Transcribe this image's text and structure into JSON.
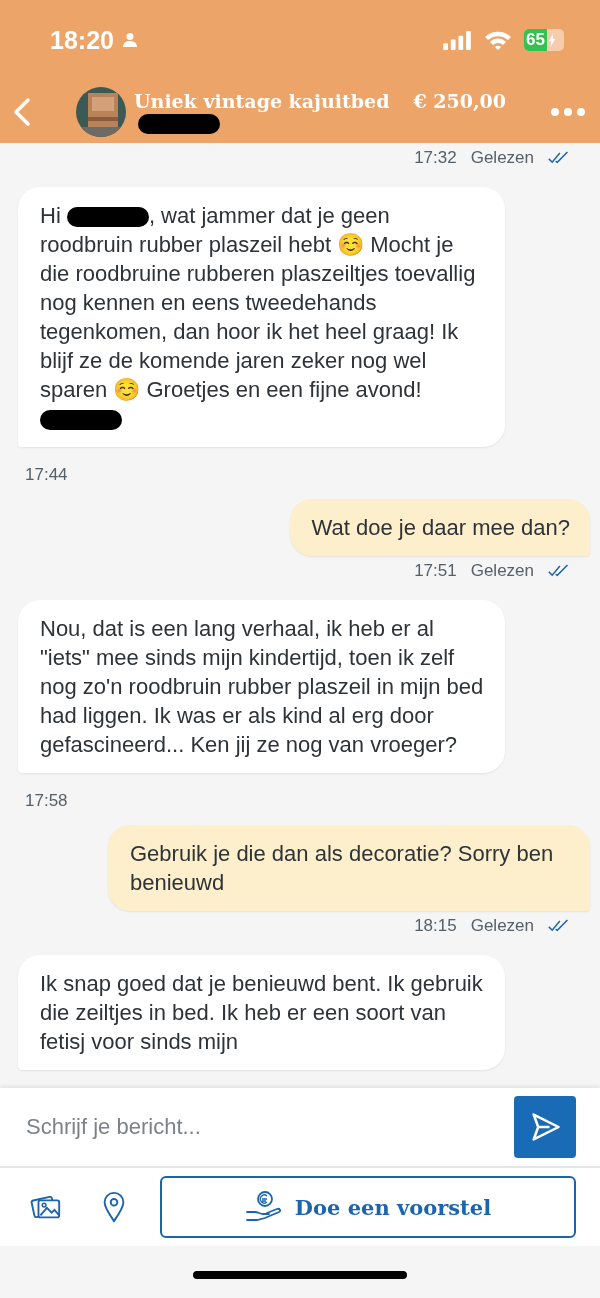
{
  "status_bar": {
    "time": "18:20",
    "battery": "65"
  },
  "header": {
    "title": "Uniek vintage kajuitbed",
    "price": "€ 250,00"
  },
  "chat": [
    {
      "kind": "receipt",
      "time": "17:32",
      "status": "Gelezen",
      "read": true
    },
    {
      "kind": "message",
      "mine": false,
      "parts": [
        {
          "kind": "text",
          "text": "Hi "
        },
        {
          "kind": "redacted"
        },
        {
          "kind": "text",
          "text": ", wat jammer dat je geen roodbruin rubber plaszeil hebt ☺️ Mocht je die roodbruine rubberen plaszeiltjes toevallig nog kennen en eens tweedehands tegenkomen, dan hoor ik het heel graag! Ik blijf ze de komende jaren zeker nog wel sparen ☺️ Groetjes en een fijne avond! "
        },
        {
          "kind": "redacted"
        }
      ]
    },
    {
      "kind": "time",
      "time": "17:44"
    },
    {
      "kind": "message",
      "mine": true,
      "parts": [
        {
          "kind": "text",
          "text": "Wat doe je daar mee dan?"
        }
      ]
    },
    {
      "kind": "receipt",
      "time": "17:51",
      "status": "Gelezen",
      "read": true
    },
    {
      "kind": "message",
      "mine": false,
      "parts": [
        {
          "kind": "text",
          "text": "Nou, dat is een lang verhaal, ik heb er al \"iets\" mee sinds mijn kindertijd, toen ik zelf nog zo'n roodbruin rubber plaszeil in mijn bed had liggen. Ik was er als kind al erg door gefascineerd... Ken jij ze nog van vroeger?"
        }
      ]
    },
    {
      "kind": "time",
      "time": "17:58"
    },
    {
      "kind": "message",
      "mine": true,
      "parts": [
        {
          "kind": "text",
          "text": "Gebruik je die dan als decoratie? Sorry ben benieuwd"
        }
      ]
    },
    {
      "kind": "receipt",
      "time": "18:15",
      "status": "Gelezen",
      "read": true
    },
    {
      "kind": "message",
      "mine": false,
      "parts": [
        {
          "kind": "text",
          "text": "Ik snap goed dat je benieuwd bent. Ik gebruik die zeiltjes in bed. Ik heb er een soort van fetisj voor sinds mijn"
        }
      ]
    }
  ],
  "composer": {
    "placeholder": "Schrijf je bericht..."
  },
  "actions": {
    "offer_button": "Doe een voorstel"
  }
}
